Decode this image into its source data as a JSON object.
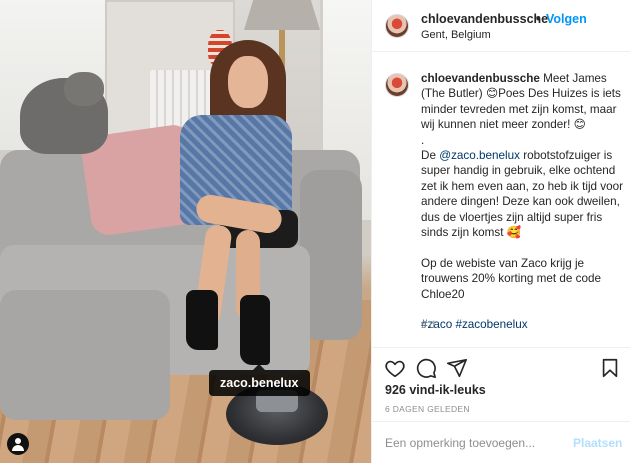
{
  "post": {
    "tag_label": "zaco.benelux"
  },
  "header": {
    "username": "chloevandenbussche",
    "dot": "•",
    "follow_label": "Volgen",
    "location": "Gent, Belgium"
  },
  "caption": {
    "username": "chloevandenbussche",
    "line1": "Meet James (The Butler) 😊Poes Des Huizes is iets minder tevreden met zijn komst, maar wij kunnen niet meer zonder! 😊",
    "dot_line": ".",
    "line2_prefix": "De ",
    "mention": "@zaco.benelux",
    "line2_suffix": " robotstofzuiger is super handig in gebruik, elke ochtend zet ik hem even aan, zo heb ik tijd voor andere dingen! Deze kan ook dweilen, dus de vloertjes zijn altijd super fris sinds zijn komst 🥰",
    "line3": "Op de webiste van Zaco krijg je trouwens 20% korting met de code Chloe20",
    "hashtag1": "#zaco",
    "hashtag2": "#zacobenelux",
    "time_ago": "6 d."
  },
  "actions": {
    "icons": [
      "heart-icon",
      "comment-icon",
      "share-icon",
      "bookmark-icon"
    ]
  },
  "likes_text": "926 vind-ik-leuks",
  "posted_text": "6 DAGEN GELEDEN",
  "comment": {
    "placeholder": "Een opmerking toevoegen...",
    "post_label": "Plaatsen"
  },
  "colors": {
    "link_blue": "#0095f6",
    "mention_blue": "#00376b",
    "post_disabled": "#b2dffc",
    "muted_text": "#8e8e8e"
  }
}
